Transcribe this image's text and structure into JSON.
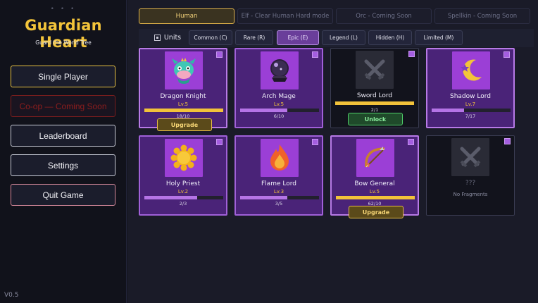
{
  "sidebar": {
    "dots": "• • •",
    "title": "Guardian Heart",
    "subtitle": "Guard the World Tree",
    "menu": [
      {
        "label": "Single Player",
        "state": "primary"
      },
      {
        "label": "Co-op — Coming Soon",
        "state": "disabled"
      },
      {
        "label": "Leaderboard",
        "state": "normal"
      },
      {
        "label": "Settings",
        "state": "normal"
      },
      {
        "label": "Quit Game",
        "state": "danger"
      }
    ],
    "version": "V0.5"
  },
  "race_tabs": [
    {
      "label": "Human",
      "active": true
    },
    {
      "label": "Elf - Clear Human Hard mode",
      "active": false
    },
    {
      "label": "Orc - Coming Soon",
      "active": false
    },
    {
      "label": "Spellkin - Coming Soon",
      "active": false
    }
  ],
  "filters": {
    "units_label": "Units",
    "tabs": [
      {
        "label": "Common (C)",
        "active": false
      },
      {
        "label": "Rare (R)",
        "active": false
      },
      {
        "label": "Epic (E)",
        "active": true
      },
      {
        "label": "Legend (L)",
        "active": false
      },
      {
        "label": "Hidden (H)",
        "active": false
      },
      {
        "label": "Limited (M)",
        "active": false
      }
    ]
  },
  "units": [
    {
      "name": "Dragon Knight",
      "level": "Lv.5",
      "fragments": "18/10",
      "progress": 1.0,
      "action": "Upgrade",
      "state": "owned",
      "icon": "dragon-icon"
    },
    {
      "name": "Arch Mage",
      "level": "Lv.5",
      "fragments": "6/10",
      "progress": 0.6,
      "action": "",
      "state": "owned",
      "icon": "crystal-ball-icon"
    },
    {
      "name": "Sword Lord",
      "level": "",
      "fragments": "2/1",
      "progress": 1.0,
      "action": "Unlock",
      "state": "locked",
      "icon": "crossed-swords-icon"
    },
    {
      "name": "Shadow Lord",
      "level": "Lv.7",
      "fragments": "7/17",
      "progress": 0.41,
      "action": "",
      "state": "owned",
      "icon": "crescent-moon-icon"
    },
    {
      "name": "Holy Priest",
      "level": "Lv.2",
      "fragments": "2/3",
      "progress": 0.67,
      "action": "",
      "state": "owned",
      "icon": "sun-icon"
    },
    {
      "name": "Flame Lord",
      "level": "Lv.3",
      "fragments": "3/5",
      "progress": 0.6,
      "action": "",
      "state": "owned",
      "icon": "flame-icon"
    },
    {
      "name": "Bow General",
      "level": "Lv.5",
      "fragments": "62/10",
      "progress": 1.0,
      "action": "Upgrade",
      "state": "owned",
      "icon": "bow-icon"
    },
    {
      "name": "???",
      "level": "",
      "fragments": "No Fragments",
      "progress": 0,
      "action": "",
      "state": "no-fragments",
      "icon": "crossed-swords-icon"
    }
  ],
  "colors": {
    "accent_gold": "#f3c43a",
    "epic_purple": "#9b3fd6",
    "unlock_green": "#4fcf6a",
    "coming_soon_red": "#8e1d1d"
  }
}
